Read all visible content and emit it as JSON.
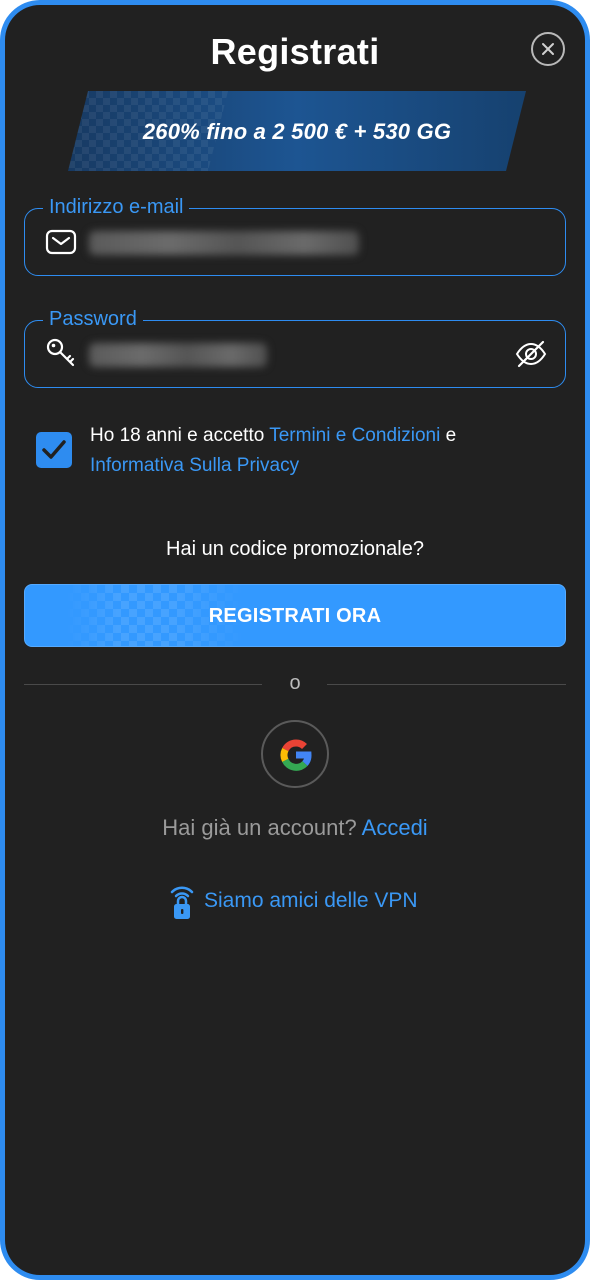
{
  "header": {
    "title": "Registrati",
    "close_icon": "close-icon"
  },
  "banner": {
    "text": "260% fino a 2 500 € + 530 GG"
  },
  "form": {
    "email": {
      "legend": "Indirizzo e-mail",
      "icon": "envelope-icon"
    },
    "password": {
      "legend": "Password",
      "icon": "key-icon",
      "toggle_icon": "eye-off-icon"
    },
    "terms": {
      "checked": true,
      "prefix": "Ho 18 anni e accetto ",
      "link_terms": "Termini e Condizioni",
      "middle": " e ",
      "link_privacy": "Informativa Sulla Privacy"
    },
    "promo_label": "Hai un codice promozionale?",
    "submit_label": "REGISTRATI ORA"
  },
  "divider": {
    "text": "o"
  },
  "social": {
    "google_icon": "google-icon"
  },
  "footer": {
    "account_prompt": "Hai già un account?",
    "login_link": "Accedi",
    "vpn_label": "Siamo amici delle VPN",
    "vpn_icon": "wifi-lock-icon"
  },
  "colors": {
    "accent": "#2e8cf0",
    "link": "#3a98f5",
    "background": "#212121",
    "button": "#3399ff"
  }
}
